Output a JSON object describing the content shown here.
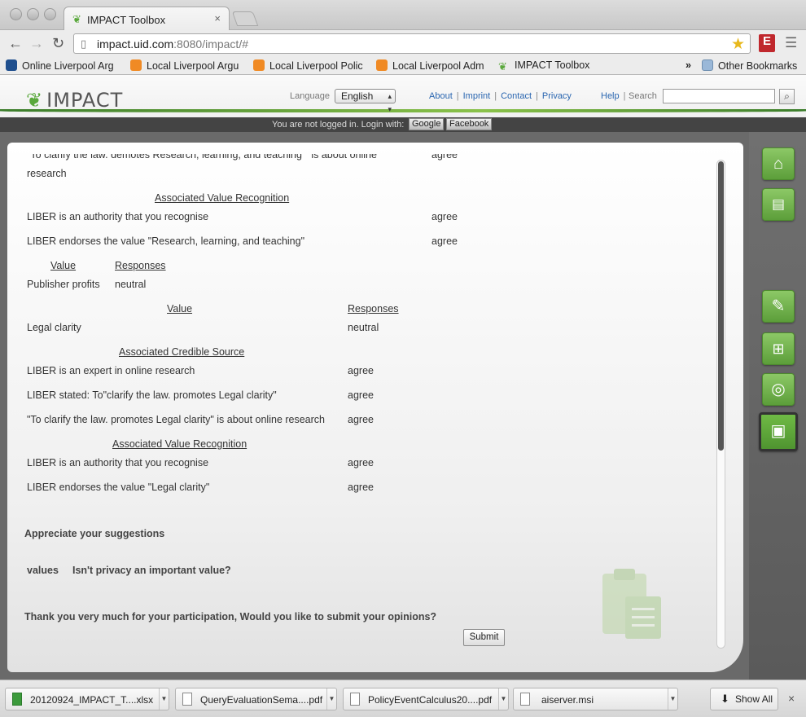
{
  "browser": {
    "tab_title": "IMPACT Toolbox",
    "tab_close": "×",
    "url_host": "impact.uid.com",
    "url_rest": ":8080/impact/#",
    "ext_badge": "E",
    "bookmarks": [
      {
        "label": "Online Liverpool Arg",
        "icon": "globe-icon"
      },
      {
        "label": "Local Liverpool Argu",
        "icon": "xampp-icon"
      },
      {
        "label": "Local Liverpool Polic",
        "icon": "xampp-icon"
      },
      {
        "label": "Local Liverpool Adm",
        "icon": "xampp-icon"
      },
      {
        "label": "IMPACT Toolbox",
        "icon": "impact-leaf-icon"
      }
    ],
    "bookmarks_overflow": "»",
    "other_bookmarks": "Other Bookmarks"
  },
  "header": {
    "logo_text": "IMPACT",
    "language_label": "Language",
    "language_value": "English",
    "links": [
      "About",
      "Imprint",
      "Contact",
      "Privacy"
    ],
    "help": "Help",
    "search_label": "Search",
    "login_text": "You are not logged in. Login with:",
    "login_google": "Google",
    "login_facebook": "Facebook"
  },
  "content": {
    "top_line1": "\"To clarify the law. demotes Research, learning, and teaching \" is about online",
    "top_line2": "research",
    "top_resp": "agree",
    "avr1_heading": "Associated Value Recognition",
    "avr1_rows": [
      {
        "text": "LIBER is an authority that you recognise",
        "resp": "agree"
      },
      {
        "text": "LIBER endorses the value \"Research, learning, and teaching\"",
        "resp": "agree"
      }
    ],
    "table1_h_value": "Value",
    "table1_h_responses": "Responses",
    "table1_row_value": "Publisher profits",
    "table1_row_resp": "neutral",
    "table2_h_value": "Value",
    "table2_h_responses": "Responses",
    "table2_row_value": "Legal clarity",
    "table2_row_resp": "neutral",
    "acs_heading": "Associated Credible Source",
    "acs_rows": [
      {
        "text": "LIBER is an expert in online research",
        "resp": "agree"
      },
      {
        "text": "LIBER stated: To\"clarify the law. promotes Legal clarity\"",
        "resp": "agree"
      },
      {
        "text": "\"To clarify the law. promotes Legal clarity\" is about online research",
        "resp": "agree"
      }
    ],
    "avr2_heading": "Associated Value Recognition",
    "avr2_rows": [
      {
        "text": "LIBER is an authority that you recognise",
        "resp": "agree"
      },
      {
        "text": "LIBER endorses the value \"Legal clarity\"",
        "resp": "agree"
      }
    ],
    "suggestions_heading": "Appreciate your suggestions",
    "suggestion_label": "values",
    "suggestion_text": "Isn't privacy an important value?",
    "thanks_text": "Thank you very much for your participation, Would you like to submit your opinions?",
    "submit_label": "Submit"
  },
  "sidebar": {
    "buttons": [
      "home-icon",
      "comment-icon",
      "pen-icon",
      "structure-icon",
      "target-icon",
      "clipboard-icon"
    ],
    "active": "clipboard-icon"
  },
  "downloads": {
    "items": [
      {
        "name": "20120924_IMPACT_T....xlsx",
        "type": "xlsx"
      },
      {
        "name": "QueryEvaluationSema....pdf",
        "type": "pdf"
      },
      {
        "name": "PolicyEventCalculus20....pdf",
        "type": "pdf"
      },
      {
        "name": "aiserver.msi",
        "type": "msi"
      }
    ],
    "show_all": "Show All",
    "close": "×"
  },
  "colors": {
    "accent_green": "#5aa83c",
    "link_blue": "#2a66b0",
    "app_bg": "#6a6a6a"
  }
}
